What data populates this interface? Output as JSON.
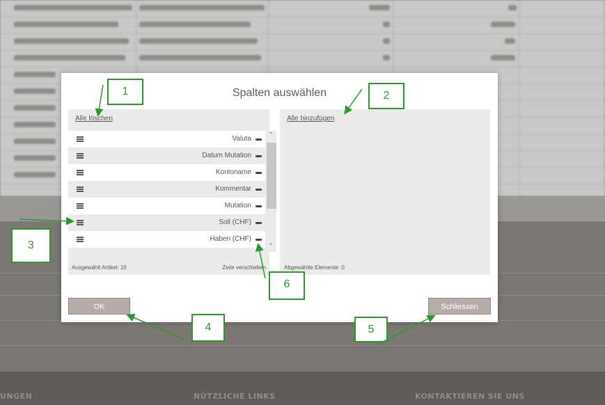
{
  "modal": {
    "title": "Spalten auswählen",
    "left_panel": {
      "clear_all_label": "Alle löschen",
      "selected_count_label": "Ausgewählt Artikel: 10",
      "move_row_label": "Zeile verschieben",
      "items": [
        {
          "label": "Valuta"
        },
        {
          "label": "Datum Mutation"
        },
        {
          "label": "Kontoname"
        },
        {
          "label": "Kommentar"
        },
        {
          "label": "Mutation"
        },
        {
          "label": "Soll (CHF)"
        },
        {
          "label": "Haben (CHF)"
        }
      ]
    },
    "right_panel": {
      "add_all_label": "Alle hinzufügen",
      "selected_elements_label": "Abgewählte Elemente: 0"
    },
    "ok_label": "OK",
    "close_label": "Schliessen"
  },
  "footer": {
    "links": [
      "UNGEN",
      "NÜTZLICHE LINKS",
      "KONTAKTIEREN SIE UNS"
    ]
  },
  "annotations": [
    "1",
    "2",
    "3",
    "4",
    "5",
    "6"
  ],
  "icons": {
    "drag": "drag-handle-icon",
    "remove": "minus-icon",
    "scroll_up": "chevron-up-icon",
    "scroll_down": "chevron-down-icon"
  },
  "colors": {
    "annotation_green": "#2a9a2a",
    "button_bg": "#b6ada9"
  }
}
